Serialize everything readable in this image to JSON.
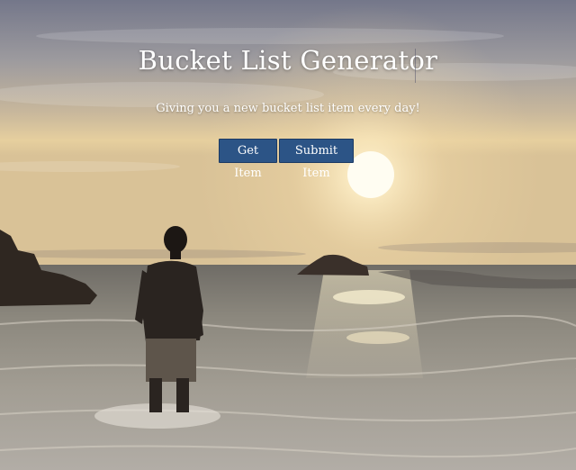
{
  "page": {
    "title": "Bucket List Generator",
    "subtitle": "Giving you a new bucket list item every day!"
  },
  "buttons": {
    "get_label": "Get Item",
    "submit_label": "Submit Item"
  },
  "colors": {
    "button_bg": "#2c5486",
    "sky_top": "#76788a",
    "sun": "#fff6d8",
    "sea": "#8a8880"
  }
}
